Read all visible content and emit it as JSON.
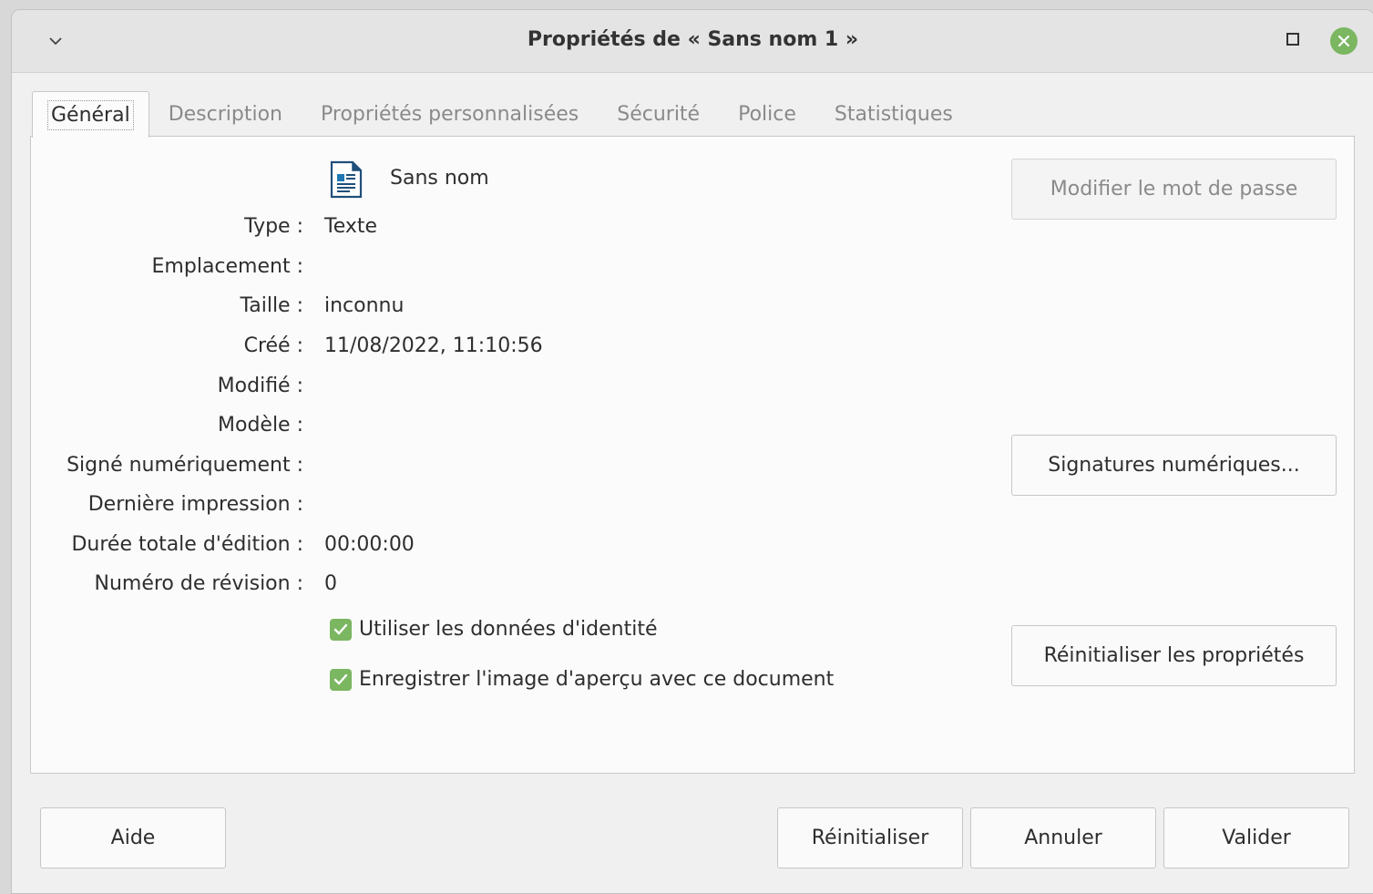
{
  "window": {
    "title": "Propriétés de « Sans nom 1 »"
  },
  "tabs": [
    {
      "label": "Général",
      "active": true
    },
    {
      "label": "Description",
      "active": false
    },
    {
      "label": "Propriétés personnalisées",
      "active": false
    },
    {
      "label": "Sécurité",
      "active": false
    },
    {
      "label": "Police",
      "active": false
    },
    {
      "label": "Statistiques",
      "active": false
    }
  ],
  "general": {
    "doc_name": "Sans nom",
    "fields": [
      {
        "label": "Type :",
        "value": "Texte"
      },
      {
        "label": "Emplacement :",
        "value": ""
      },
      {
        "label": "Taille :",
        "value": "inconnu"
      },
      {
        "label": "Créé :",
        "value": "11/08/2022, 11:10:56"
      },
      {
        "label": "Modifié :",
        "value": ""
      },
      {
        "label": "Modèle :",
        "value": ""
      },
      {
        "label": "Signé numériquement :",
        "value": ""
      },
      {
        "label": "Dernière impression :",
        "value": ""
      },
      {
        "label": "Durée totale d'édition :",
        "value": "00:00:00"
      },
      {
        "label": "Numéro de révision :",
        "value": "0"
      }
    ],
    "checkboxes": [
      {
        "label": "Utiliser les données d'identité",
        "checked": true
      },
      {
        "label": "Enregistrer l'image d'aperçu avec ce document",
        "checked": true
      }
    ],
    "buttons": {
      "change_password": "Modifier le mot de passe",
      "digital_signatures": "Signatures numériques...",
      "reset_properties": "Réinitialiser les propriétés"
    }
  },
  "footer": {
    "help": "Aide",
    "reset": "Réinitialiser",
    "cancel": "Annuler",
    "ok": "Valider"
  },
  "colors": {
    "accent": "#7bb661",
    "window_bg": "#f0f0f0",
    "panel_bg": "#fbfbfb"
  }
}
